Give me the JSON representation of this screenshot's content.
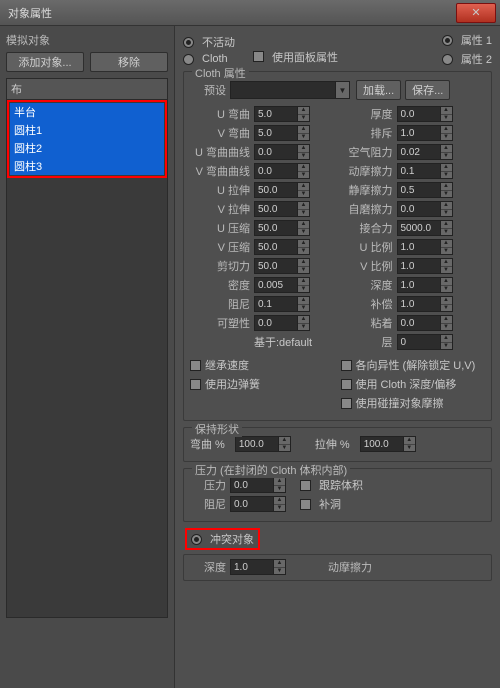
{
  "title": "对象属性",
  "left": {
    "group": "模拟对象",
    "add": "添加对象...",
    "remove": "移除",
    "listhdr": "布",
    "items": [
      "半台",
      "圆柱1",
      "圆柱2",
      "圆柱3"
    ]
  },
  "top": {
    "inactive": "不活动",
    "cloth": "Cloth",
    "usepanel": "使用面板属性",
    "prop1": "属性 1",
    "prop2": "属性 2"
  },
  "cloth": {
    "legend": "Cloth 属性",
    "preset": "预设",
    "load": "加载...",
    "save": "保存...",
    "ubend": "U 弯曲",
    "vbend": "V 弯曲",
    "ubendc": "U 弯曲曲线",
    "vbendc": "V 弯曲曲线",
    "ustr": "U 拉伸",
    "vstr": "V 拉伸",
    "ucomp": "U 压缩",
    "vcomp": "V 压缩",
    "shear": "剪切力",
    "density": "密度",
    "damp": "阻尼",
    "plast": "可塑性",
    "based": "基于:default",
    "thick": "厚度",
    "repel": "排斥",
    "air": "空气阻力",
    "dynf": "动摩擦力",
    "statf": "静摩擦力",
    "selff": "自磨擦力",
    "seam": "接合力",
    "uscl": "U 比例",
    "vscl": "V 比例",
    "depth": "深度",
    "offset": "补偿",
    "cling": "粘着",
    "layer": "层",
    "v": {
      "ubend": "5.0",
      "vbend": "5.0",
      "ubendc": "0.0",
      "vbendc": "0.0",
      "ustr": "50.0",
      "vstr": "50.0",
      "ucomp": "50.0",
      "vcomp": "50.0",
      "shear": "50.0",
      "density": "0.005",
      "damp": "0.1",
      "plast": "0.0",
      "thick": "0.0",
      "repel": "1.0",
      "air": "0.02",
      "dynf": "0.1",
      "statf": "0.5",
      "selff": "0.0",
      "seam": "5000.0",
      "uscl": "1.0",
      "vscl": "1.0",
      "depth": "1.0",
      "offset": "1.0",
      "cling": "0.0",
      "layer": "0"
    },
    "inherit": "继承速度",
    "aniso": "各向异性 (解除锁定 U,V)",
    "edgespr": "使用边弹簧",
    "clothdepth": "使用 Cloth 深度/偏移",
    "collfric": "使用碰撞对象摩擦"
  },
  "keep": {
    "legend": "保持形状",
    "bend": "弯曲 %",
    "str": "拉伸 %",
    "bv": "100.0",
    "sv": "100.0"
  },
  "press": {
    "legend": "压力 (在封闭的 Cloth 体积内部)",
    "press": "压力",
    "damp": "阻尼",
    "track": "跟踪体积",
    "patch": "补洞",
    "pv": "0.0",
    "dv": "0.0"
  },
  "coll": {
    "label": "冲突对象"
  },
  "bottom": {
    "depth": "深度",
    "dv": "1.0",
    "dfr": "动摩擦力"
  }
}
